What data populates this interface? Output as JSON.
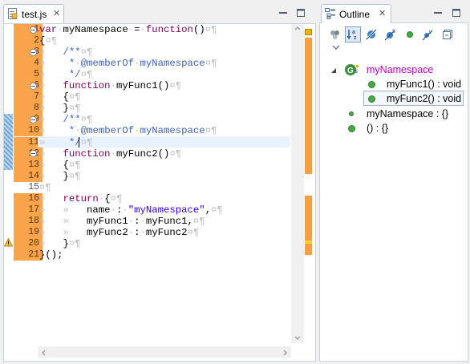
{
  "editor": {
    "tab_label": "test.js",
    "tab_close": "✕",
    "line_numbers": [
      "1",
      "2",
      "3",
      "4",
      "5",
      "6",
      "7",
      "8",
      "9",
      "10",
      "11",
      "12",
      "13",
      "14",
      "15",
      "16",
      "17",
      "18",
      "19",
      "20",
      "21"
    ],
    "changed_lines": [
      1,
      2,
      3,
      4,
      5,
      6,
      7,
      8,
      9,
      10,
      11,
      12,
      13,
      14,
      16,
      17,
      18,
      19,
      20,
      21
    ],
    "warning_line": 20,
    "code": {
      "l1": [
        [
          "kw",
          "var"
        ],
        [
          "ws",
          "·"
        ],
        [
          "plain",
          "myNamespace"
        ],
        [
          "ws",
          "·"
        ],
        [
          "plain",
          "="
        ],
        [
          "ws",
          "·"
        ],
        [
          "kw",
          "function"
        ],
        [
          "plain",
          "()"
        ],
        [
          "ws",
          "¤¶"
        ]
      ],
      "l2": [
        [
          "plain",
          "{"
        ],
        [
          "ws",
          "¤¶"
        ]
      ],
      "l3": [
        [
          "ws",
          "»   "
        ],
        [
          "doc",
          "/**"
        ],
        [
          "ws",
          "¤¶"
        ]
      ],
      "l4": [
        [
          "ws",
          "»    "
        ],
        [
          "doc",
          "*"
        ],
        [
          "ws",
          "·"
        ],
        [
          "doc",
          "@memberOf"
        ],
        [
          "ws",
          "·"
        ],
        [
          "doc",
          "myNamespace"
        ],
        [
          "ws",
          "¤¶"
        ]
      ],
      "l5": [
        [
          "ws",
          "»    "
        ],
        [
          "doc",
          "*/"
        ],
        [
          "ws",
          "¤¶"
        ]
      ],
      "l6": [
        [
          "ws",
          "»   "
        ],
        [
          "kw",
          "function"
        ],
        [
          "ws",
          "·"
        ],
        [
          "plain",
          "myFunc1()"
        ],
        [
          "ws",
          "¤¶"
        ]
      ],
      "l7": [
        [
          "ws",
          "»   "
        ],
        [
          "plain",
          "{"
        ],
        [
          "ws",
          "¤¶"
        ]
      ],
      "l8": [
        [
          "ws",
          "»   "
        ],
        [
          "plain",
          "}"
        ],
        [
          "ws",
          "¤¶"
        ]
      ],
      "l9": [
        [
          "ws",
          "»   "
        ],
        [
          "doc",
          "/**"
        ],
        [
          "ws",
          "¤¶"
        ]
      ],
      "l10": [
        [
          "ws",
          "»    "
        ],
        [
          "doc",
          "*"
        ],
        [
          "ws",
          "·"
        ],
        [
          "doc",
          "@memberOf"
        ],
        [
          "ws",
          "·"
        ],
        [
          "doc",
          "myNamespace"
        ],
        [
          "ws",
          "¤¶"
        ]
      ],
      "l11": [
        [
          "ws",
          "»    "
        ],
        [
          "doc",
          "*/"
        ],
        [
          "ws",
          "¤¶"
        ]
      ],
      "l12": [
        [
          "ws",
          "»   "
        ],
        [
          "kw",
          "function"
        ],
        [
          "ws",
          "·"
        ],
        [
          "plain",
          "myFunc2()"
        ],
        [
          "ws",
          "¤¶"
        ]
      ],
      "l13": [
        [
          "ws",
          "»   "
        ],
        [
          "plain",
          "{"
        ],
        [
          "ws",
          "¤¶"
        ]
      ],
      "l14": [
        [
          "ws",
          "»   "
        ],
        [
          "plain",
          "}"
        ],
        [
          "ws",
          "¤¶"
        ]
      ],
      "l15": [
        [
          "ws",
          "¤¶"
        ]
      ],
      "l16": [
        [
          "ws",
          "»   "
        ],
        [
          "kw",
          "return"
        ],
        [
          "ws",
          "·"
        ],
        [
          "plain",
          "{"
        ],
        [
          "ws",
          "¤¶"
        ]
      ],
      "l17": [
        [
          "ws",
          "»   »   "
        ],
        [
          "plain",
          "name"
        ],
        [
          "ws",
          "·"
        ],
        [
          "plain",
          ":"
        ],
        [
          "ws",
          "·"
        ],
        [
          "str",
          "\"myNamespace\""
        ],
        [
          "plain",
          ","
        ],
        [
          "ws",
          "¤¶"
        ]
      ],
      "l18": [
        [
          "ws",
          "»   »   "
        ],
        [
          "plain",
          "myFunc1"
        ],
        [
          "ws",
          "·"
        ],
        [
          "plain",
          ":"
        ],
        [
          "ws",
          "·"
        ],
        [
          "plain",
          "myFunc1,"
        ],
        [
          "ws",
          "¤¶"
        ]
      ],
      "l19": [
        [
          "ws",
          "»   »   "
        ],
        [
          "plain",
          "myFunc2"
        ],
        [
          "ws",
          "·"
        ],
        [
          "plain",
          ":"
        ],
        [
          "ws",
          "·"
        ],
        [
          "plain",
          "myFunc2"
        ],
        [
          "ws",
          "¤¶"
        ]
      ],
      "l20": [
        [
          "ws",
          "»   "
        ],
        [
          "plain",
          "}"
        ],
        [
          "ws",
          "¤¶"
        ]
      ],
      "l21": [
        [
          "plain",
          "}();"
        ]
      ]
    }
  },
  "outline": {
    "tab_label": "Outline",
    "tab_close": "✕",
    "root_label": "myNamespace",
    "items": [
      {
        "label": "myFunc1() : void",
        "selected": false
      },
      {
        "label": "myFunc2() : void",
        "selected": true
      }
    ],
    "top_items": [
      {
        "label": "myNamespace : {}"
      },
      {
        "label": "() : {}"
      }
    ]
  },
  "colors": {
    "changed": "#f9a34b",
    "keyword": "#7f0055",
    "string": "#2a00ff",
    "javadoc": "#3f5fbf",
    "outline_root": "#c000c0"
  },
  "icons": {
    "editor_minimize": "minimize-icon",
    "editor_maximize": "maximize-icon",
    "outline_minimize": "minimize-icon",
    "outline_maximize": "maximize-icon",
    "toolbar": [
      "hide-fields-icon",
      "sort-icon",
      "hide-static-icon",
      "hide-non-public-icon",
      "hide-local-types-icon",
      "collapse-all-icon",
      "view-menu-icon"
    ]
  }
}
